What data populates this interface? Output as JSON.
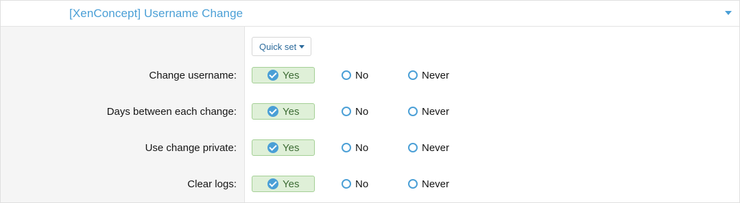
{
  "header": {
    "title": "[XenConcept] Username Change"
  },
  "quick_set": {
    "label": "Quick set"
  },
  "options": {
    "yes": "Yes",
    "no": "No",
    "never": "Never"
  },
  "permissions": [
    {
      "label": "Change username:",
      "selected": "yes"
    },
    {
      "label": "Days between each change:",
      "selected": "yes"
    },
    {
      "label": "Use change private:",
      "selected": "yes"
    },
    {
      "label": "Clear logs:",
      "selected": "yes"
    }
  ],
  "colors": {
    "accent": "#4a9fd6",
    "selected_bg": "#dff0d8",
    "selected_border": "#a3cf94"
  }
}
